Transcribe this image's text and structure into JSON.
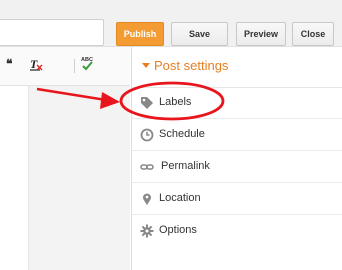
{
  "toolbar": {
    "publish_label": "Publish",
    "save_label": "Save",
    "preview_label": "Preview",
    "close_label": "Close"
  },
  "editor": {
    "quote_glyph": "❝",
    "clear_format_glyph": "T̶",
    "spellcheck_label": "ABC"
  },
  "sidebar": {
    "header": "Post settings",
    "items": [
      {
        "label": "Labels",
        "icon": "tag-icon"
      },
      {
        "label": "Schedule",
        "icon": "clock-icon"
      },
      {
        "label": "Permalink",
        "icon": "link-icon"
      },
      {
        "label": "Location",
        "icon": "pin-icon"
      },
      {
        "label": "Options",
        "icon": "gear-icon"
      }
    ]
  },
  "colors": {
    "accent": "#e67e22",
    "publish": "#f39c34",
    "annotation": "#e8151c"
  }
}
